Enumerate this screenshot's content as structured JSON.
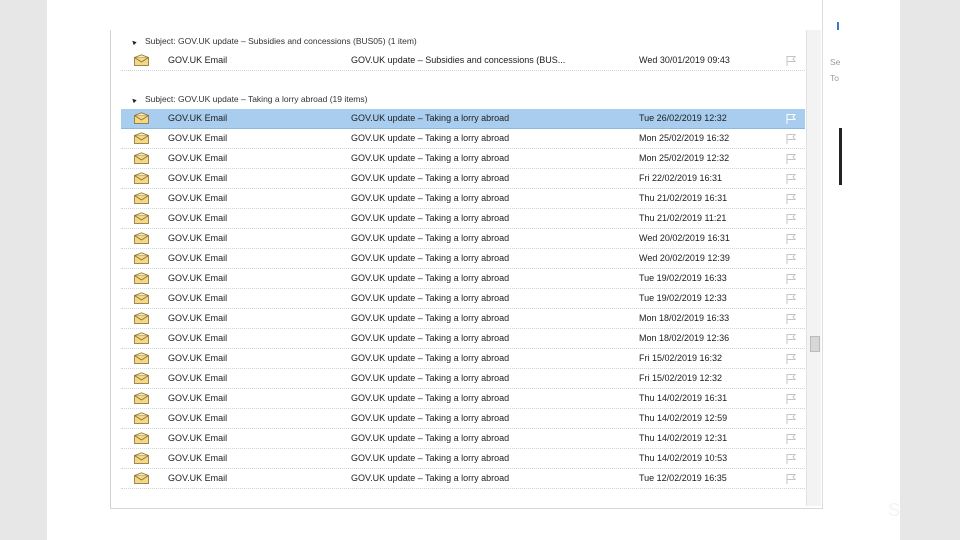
{
  "groups": [
    {
      "header": "Subject: GOV.UK update – Subsidies and concessions (BUS05) (1 item)",
      "rows": [
        {
          "from": "GOV.UK Email",
          "subject": "GOV.UK update – Subsidies and concessions (BUS...",
          "date": "Wed 30/01/2019 09:43",
          "selected": false
        }
      ]
    },
    {
      "header": "Subject: GOV.UK update – Taking a lorry abroad (19 items)",
      "rows": [
        {
          "from": "GOV.UK Email",
          "subject": "GOV.UK update – Taking a lorry abroad",
          "date": "Tue 26/02/2019 12:32",
          "selected": true
        },
        {
          "from": "GOV.UK Email",
          "subject": "GOV.UK update – Taking a lorry abroad",
          "date": "Mon 25/02/2019 16:32",
          "selected": false
        },
        {
          "from": "GOV.UK Email",
          "subject": "GOV.UK update – Taking a lorry abroad",
          "date": "Mon 25/02/2019 12:32",
          "selected": false
        },
        {
          "from": "GOV.UK Email",
          "subject": "GOV.UK update – Taking a lorry abroad",
          "date": "Fri 22/02/2019 16:31",
          "selected": false
        },
        {
          "from": "GOV.UK Email",
          "subject": "GOV.UK update – Taking a lorry abroad",
          "date": "Thu 21/02/2019 16:31",
          "selected": false
        },
        {
          "from": "GOV.UK Email",
          "subject": "GOV.UK update – Taking a lorry abroad",
          "date": "Thu 21/02/2019 11:21",
          "selected": false
        },
        {
          "from": "GOV.UK Email",
          "subject": "GOV.UK update – Taking a lorry abroad",
          "date": "Wed 20/02/2019 16:31",
          "selected": false
        },
        {
          "from": "GOV.UK Email",
          "subject": "GOV.UK update – Taking a lorry abroad",
          "date": "Wed 20/02/2019 12:39",
          "selected": false
        },
        {
          "from": "GOV.UK Email",
          "subject": "GOV.UK update – Taking a lorry abroad",
          "date": "Tue 19/02/2019 16:33",
          "selected": false
        },
        {
          "from": "GOV.UK Email",
          "subject": "GOV.UK update – Taking a lorry abroad",
          "date": "Tue 19/02/2019 12:33",
          "selected": false
        },
        {
          "from": "GOV.UK Email",
          "subject": "GOV.UK update – Taking a lorry abroad",
          "date": "Mon 18/02/2019 16:33",
          "selected": false
        },
        {
          "from": "GOV.UK Email",
          "subject": "GOV.UK update – Taking a lorry abroad",
          "date": "Mon 18/02/2019 12:36",
          "selected": false
        },
        {
          "from": "GOV.UK Email",
          "subject": "GOV.UK update – Taking a lorry abroad",
          "date": "Fri 15/02/2019 16:32",
          "selected": false
        },
        {
          "from": "GOV.UK Email",
          "subject": "GOV.UK update – Taking a lorry abroad",
          "date": "Fri 15/02/2019 12:32",
          "selected": false
        },
        {
          "from": "GOV.UK Email",
          "subject": "GOV.UK update – Taking a lorry abroad",
          "date": "Thu 14/02/2019 16:31",
          "selected": false
        },
        {
          "from": "GOV.UK Email",
          "subject": "GOV.UK update – Taking a lorry abroad",
          "date": "Thu 14/02/2019 12:59",
          "selected": false
        },
        {
          "from": "GOV.UK Email",
          "subject": "GOV.UK update – Taking a lorry abroad",
          "date": "Thu 14/02/2019 12:31",
          "selected": false
        },
        {
          "from": "GOV.UK Email",
          "subject": "GOV.UK update – Taking a lorry abroad",
          "date": "Thu 14/02/2019 10:53",
          "selected": false
        },
        {
          "from": "GOV.UK Email",
          "subject": "GOV.UK update – Taking a lorry abroad",
          "date": "Tue 12/02/2019 16:35",
          "selected": false
        }
      ]
    }
  ],
  "reading_pane": {
    "line1": "Se",
    "line2": "To"
  },
  "icons": {
    "group_toggle": "collapse-triangle-icon",
    "message": "envelope-icon",
    "flag": "flag-icon"
  },
  "colors": {
    "selected_row": "#a9cdee",
    "envelope": "#e6b94a"
  },
  "corner_glyph": "S"
}
